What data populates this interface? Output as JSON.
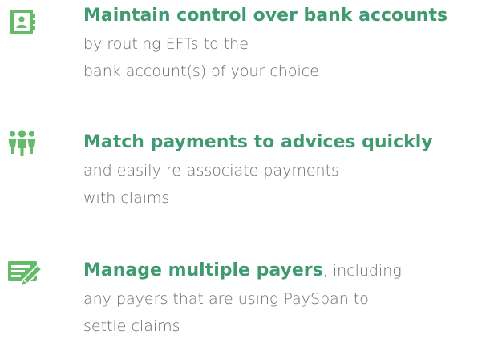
{
  "features": [
    {
      "icon": "contact-book-icon",
      "headline": "Maintain control over bank accounts",
      "headline_suffix": "",
      "lines": [
        "by routing EFTs to the",
        "bank account(s) of your choice"
      ]
    },
    {
      "icon": "people-group-icon",
      "headline": "Match payments to advices quickly",
      "headline_suffix": "",
      "lines": [
        "and easily re-associate payments",
        "with claims"
      ]
    },
    {
      "icon": "edit-document-icon",
      "headline": "Manage multiple payers",
      "headline_suffix": ", including",
      "lines": [
        "any payers that are using PaySpan to",
        "settle claims"
      ]
    }
  ],
  "colors": {
    "accent": "#3f9a72",
    "icon": "#66bb6a",
    "body_text": "#6a6a6a"
  }
}
